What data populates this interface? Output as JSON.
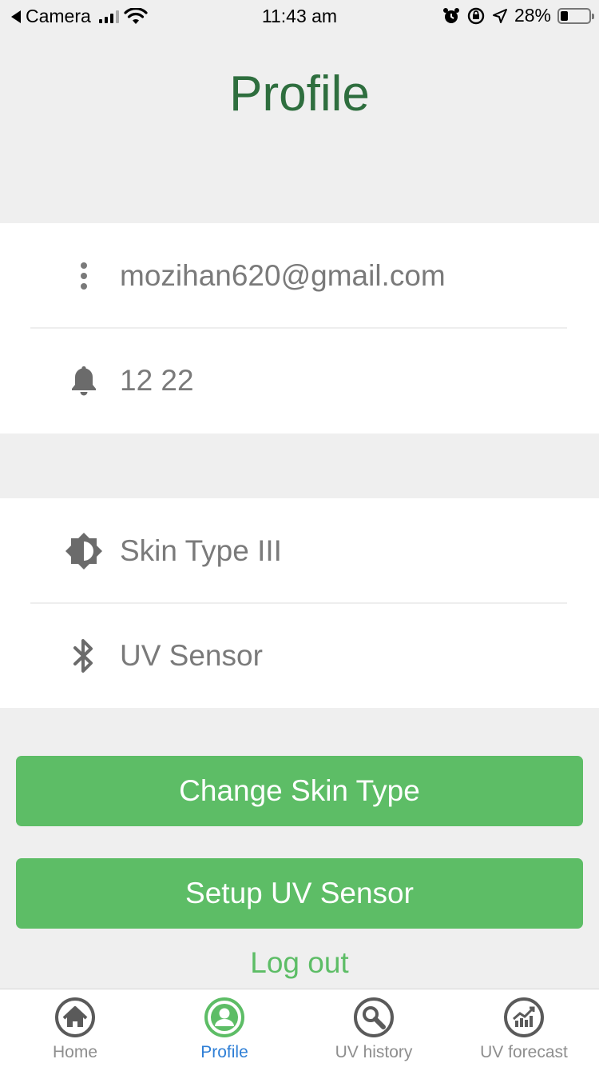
{
  "status_bar": {
    "back_app": "Camera",
    "time": "11:43 am",
    "battery": "28%"
  },
  "header": {
    "title": "Profile"
  },
  "account": {
    "email": "mozihan620@gmail.com",
    "reminder": "12 22"
  },
  "settings": {
    "skin_type": "Skin Type III",
    "sensor": "UV Sensor"
  },
  "actions": {
    "change_skin_type": "Change Skin Type",
    "setup_sensor": "Setup UV Sensor",
    "logout": "Log out"
  },
  "tab_bar": {
    "active": "Profile",
    "tabs": [
      {
        "label": "Home",
        "icon": "home-icon"
      },
      {
        "label": "Profile",
        "icon": "profile-icon"
      },
      {
        "label": "UV history",
        "icon": "search-history-icon"
      },
      {
        "label": "UV forecast",
        "icon": "chart-forecast-icon"
      }
    ]
  },
  "colors": {
    "accent": "#5dbd66",
    "title": "#2e6e3e",
    "active_tab": "#2f7fd6",
    "background": "#efefef"
  }
}
